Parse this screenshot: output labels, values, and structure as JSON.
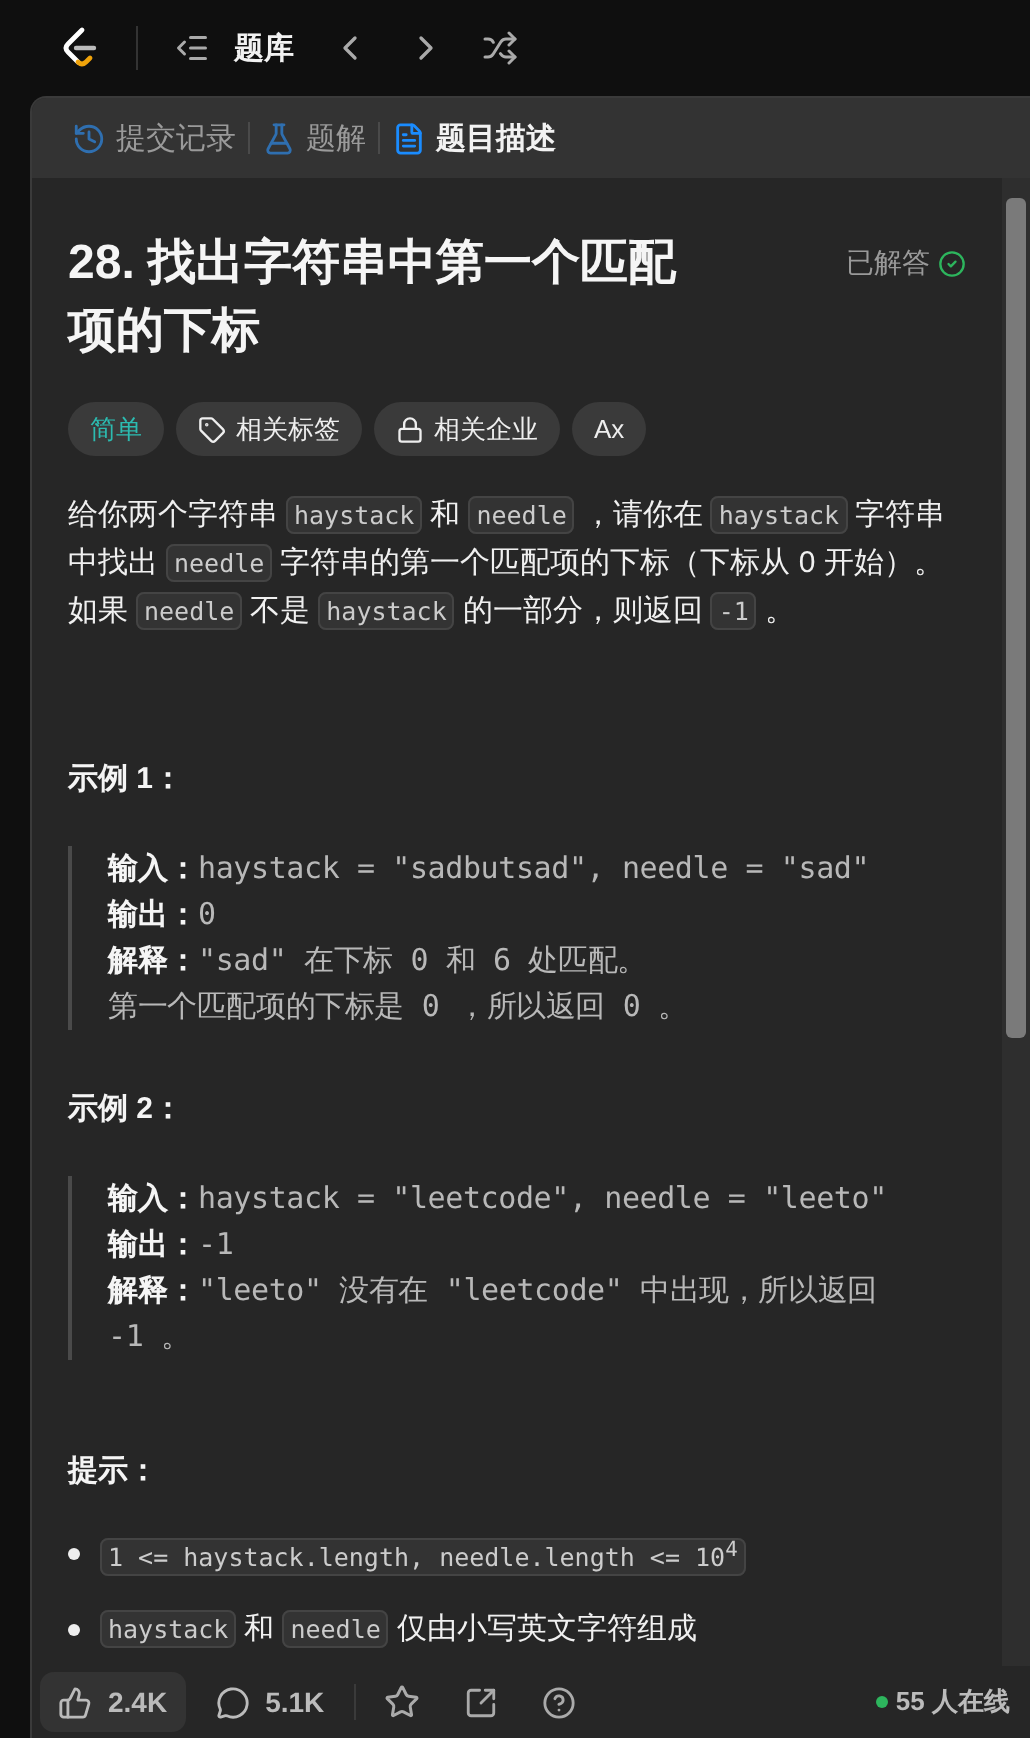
{
  "top_bar": {
    "title": "题库"
  },
  "tabs": [
    {
      "label": "提交记录",
      "selected": false
    },
    {
      "label": "题解",
      "selected": false
    },
    {
      "label": "题目描述",
      "selected": true
    }
  ],
  "problem": {
    "title": "28. 找出字符串中第一个匹配项的下标",
    "status": "已解答"
  },
  "tags": [
    {
      "kind": "difficulty",
      "label": "简单"
    },
    {
      "kind": "topics",
      "label": "相关标签"
    },
    {
      "kind": "companies",
      "label": "相关企业"
    },
    {
      "kind": "translate",
      "label": "Ax"
    }
  ],
  "description": [
    {
      "kind": "text",
      "text": "给你两个字符串"
    },
    {
      "kind": "code",
      "text": "haystack"
    },
    {
      "kind": "text",
      "text": "和"
    },
    {
      "kind": "code",
      "text": "needle"
    },
    {
      "kind": "text",
      "text": "，请你在"
    },
    {
      "kind": "code",
      "text": "haystack"
    },
    {
      "kind": "text",
      "text": "字符串中找出"
    },
    {
      "kind": "code",
      "text": "needle"
    },
    {
      "kind": "text",
      "text": "字符串的第一个匹配项的下标（下标从 0 开始）。如果"
    },
    {
      "kind": "code",
      "text": "needle"
    },
    {
      "kind": "text",
      "text": "不是"
    },
    {
      "kind": "code",
      "text": "haystack"
    },
    {
      "kind": "text",
      "text": "的一部分，则返回"
    },
    {
      "kind": "code",
      "text": "-1"
    },
    {
      "kind": "text",
      "text": "。"
    }
  ],
  "examples": [
    {
      "heading": "示例 1：",
      "lines": [
        {
          "label": "输入：",
          "value": "haystack = \"sadbutsad\", needle = \"sad\""
        },
        {
          "label": "输出：",
          "value": "0"
        },
        {
          "label": "解释：",
          "value": "\"sad\" 在下标 0 和 6 处匹配。"
        },
        {
          "value": "第一个匹配项的下标是 0 ，所以返回 0 。"
        }
      ]
    },
    {
      "heading": "示例 2：",
      "lines": [
        {
          "label": "输入：",
          "value": "haystack = \"leetcode\", needle = \"leeto\""
        },
        {
          "label": "输出：",
          "value": "-1"
        },
        {
          "label": "解释：",
          "value": "\"leeto\" 没有在 \"leetcode\" 中出现，所以返回"
        },
        {
          "value": "-1 。"
        }
      ]
    }
  ],
  "constraints": {
    "heading": "提示：",
    "items": [
      [
        {
          "kind": "code",
          "text": "1 <= haystack.length, needle.length <= 10$^{4}$"
        }
      ],
      [
        {
          "kind": "code",
          "text": "haystack"
        },
        {
          "kind": "text",
          "text": "和"
        },
        {
          "kind": "code",
          "text": "needle"
        },
        {
          "kind": "text",
          "text": "仅由小写英文字符组成"
        }
      ]
    ]
  },
  "footer": {
    "likes": "2.4K",
    "comments": "5.1K",
    "online": "55 人在线"
  }
}
